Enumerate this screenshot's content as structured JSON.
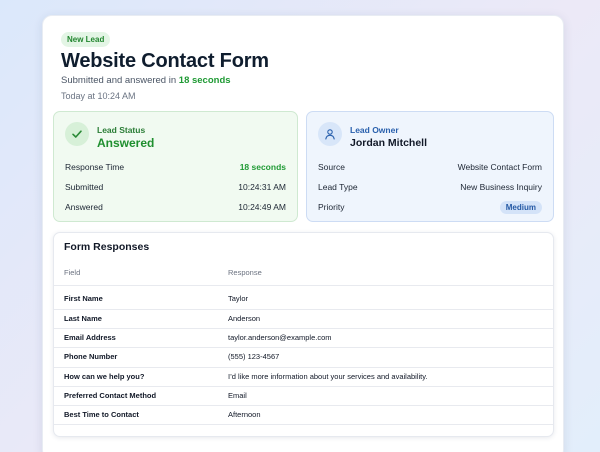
{
  "header": {
    "badge": "New Lead",
    "title": "Website Contact Form",
    "subtitle_prefix": "Submitted and answered in ",
    "subtitle_highlight": "18 seconds",
    "timestamp": "Today at 10:24 AM"
  },
  "lead_status": {
    "label": "Lead Status",
    "value": "Answered",
    "icon": "check-icon",
    "rows": [
      {
        "label": "Response Time",
        "value": "18 seconds"
      },
      {
        "label": "Submitted",
        "value": "10:24:31 AM"
      },
      {
        "label": "Answered",
        "value": "10:24:49 AM"
      }
    ]
  },
  "lead_owner": {
    "label": "Lead Owner",
    "value": "Jordan Mitchell",
    "icon": "user-icon",
    "rows": [
      {
        "label": "Source",
        "value": "Website Contact Form"
      },
      {
        "label": "Lead Type",
        "value": "New Business Inquiry"
      },
      {
        "label": "Priority",
        "value": "Medium"
      }
    ]
  },
  "responses": {
    "title": "Form Responses",
    "columns": [
      "Field",
      "Response"
    ],
    "rows": [
      {
        "field": "First Name",
        "response": "Taylor"
      },
      {
        "field": "Last Name",
        "response": "Anderson"
      },
      {
        "field": "Email Address",
        "response": "taylor.anderson@example.com"
      },
      {
        "field": "Phone Number",
        "response": "(555) 123-4567"
      },
      {
        "field": "How can we help you?",
        "response": "I’d like more information about your services and availability."
      },
      {
        "field": "Preferred Contact Method",
        "response": "Email"
      },
      {
        "field": "Best Time to Contact",
        "response": "Afternoon"
      }
    ]
  },
  "colors": {
    "success": "#1f9a34",
    "accent_blue": "#2960ad",
    "priority_bg": "#d4e3f8"
  }
}
